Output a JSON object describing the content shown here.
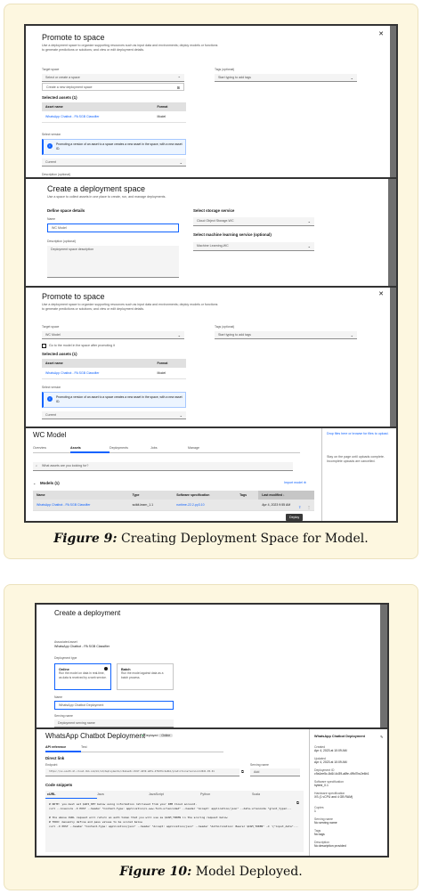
{
  "figure9": {
    "caption_label": "Figure 9:",
    "caption_text": " Creating Deployment Space for Model.",
    "promote1": {
      "title": "Promote to space",
      "description": "Use a deployment space to organize supporting resources such as input data and environments; deploy models or functions to generate predictions or solutions; and view or edit deployment details.",
      "target_space_label": "Target space",
      "target_space_placeholder": "Select or create a space",
      "create_option": "Create a new deployment space",
      "tags_label": "Tags (optional)",
      "tags_placeholder": "Start typing to add tags",
      "selected_assets": "Selected assets (1)",
      "col_asset_name": "Asset name",
      "col_format": "Format",
      "asset_name": "WhatsApp Chatbot - PA SGB Classifier",
      "asset_format": "Model",
      "select_version_label": "Select version",
      "notice": "Promoting a version of an asset to a space creates a new asset in the space, with a new asset ID.",
      "version_value": "Current",
      "description_label": "Description (optional)"
    },
    "create_space": {
      "title": "Create a deployment space",
      "description": "Use a space to collect assets in one place to create, run, and manage deployments.",
      "define_label": "Define space details",
      "name_label": "Name",
      "name_value": "WC Model",
      "desc_label": "Description (optional)",
      "desc_placeholder": "Deployment space description",
      "storage_label": "Select storage service",
      "storage_value": "Cloud Object Storage-WC",
      "ml_label": "Select machine learning service (optional)",
      "ml_value": "Machine Learning-WC"
    },
    "promote2": {
      "title": "Promote to space",
      "description": "Use a deployment space to organize supporting resources such as input data and environments; deploy models or functions to generate predictions or solutions; and view or edit deployment details.",
      "target_space_label": "Target space",
      "target_space_value": "WC Model",
      "goto_label": "Go to the model in the space after promoting it",
      "tags_label": "Tags (optional)",
      "tags_placeholder": "Start typing to add tags",
      "selected_assets": "Selected assets (1)",
      "col_asset_name": "Asset name",
      "col_format": "Format",
      "asset_name": "WhatsApp Chatbot - PA SGB Classifier",
      "asset_format": "Model",
      "select_version_label": "Select version",
      "notice": "Promoting a version of an asset to a space creates a new asset in the space, with a new asset ID.",
      "version_value": "Current"
    },
    "space_view": {
      "title": "WC Model",
      "tabs": [
        "Overview",
        "Assets",
        "Deployments",
        "Jobs",
        "Manage"
      ],
      "active_tab": "Assets",
      "search_placeholder": "What assets are you looking for?",
      "models_heading": "Models (1)",
      "import_link": "Import model",
      "columns": [
        "Name",
        "Type",
        "Software specification",
        "Tags",
        "Last modified"
      ],
      "row": {
        "name": "WhatsApp Chatbot - PA SGB Classifier",
        "type": "scikit-learn_1.1",
        "spec": "runtime-22.2-py3.10",
        "tags": "",
        "modified": "Apr 4, 2023 9:55 AM"
      },
      "tooltip": "Deploy",
      "side_text_1": "Drop files here or browse for files to upload.",
      "side_text_2": "Stay on the page until uploads complete. Incomplete uploads are cancelled."
    }
  },
  "figure10": {
    "caption_label": "Figure 10:",
    "caption_text": " Model Deployed.",
    "create_deploy": {
      "title": "Create a deployment",
      "asset_label": "Associated asset",
      "asset_value": "WhatsApp Chatbot - PA SGB Classifier",
      "deploy_type_label": "Deployment type",
      "online_title": "Online",
      "online_desc": "Run the model on data in real-time, as data is received by a web service.",
      "batch_title": "Batch",
      "batch_desc": "Run the model against data as a batch process.",
      "name_label": "Name",
      "name_value": "WhatsApp Chatbot Deployment",
      "serving_label": "Serving name",
      "serving_placeholder": "Deployment serving name"
    },
    "deployed": {
      "title": "WhatsApp Chatbot Deployment",
      "status": "Deployed",
      "status_tag": "Online",
      "tabs": [
        "API reference",
        "Test"
      ],
      "active_tab": "API reference",
      "direct_link": "Direct link",
      "endpoint_label": "Endpoint",
      "endpoint_value": "https://us-south.ml.cloud.ibm.com/ml/v4/deployments/c9a1ee5c-8d1f-4d39-a8fe-4f9d7bc2e6b1/predictions?version=2021-05-01",
      "serving_label": "Serving name",
      "serving_value": "Add",
      "snippets_label": "Code snippets",
      "code_tabs": [
        "cURL",
        "Java",
        "JavaScript",
        "Python",
        "Scala"
      ],
      "active_code_tab": "cURL",
      "code": "# NOTE: you must set $API_KEY below using information retrieved from your IBM Cloud account.\ncurl --insecure -X POST --header \"Content-Type: application/x-www-form-urlencoded\" --header \"Accept: application/json\" --data-urlencode \"grant_type=...\n\n# the above CURL request will return an auth token that you will use as $IAM_TOKEN in the scoring request below\n# TODO: manually define and pass values to be scored below\ncurl -X POST --header \"Content-Type: application/json\" --header \"Accept: application/json\" --header \"Authorization: Bearer $IAM_TOKEN\" -d '{\"input_data\"...",
      "side_title": "WhatsApp Chatbot Deployment",
      "side_rows": [
        {
          "label": "Created",
          "value": "Apr 4, 2023 at 10:09 AM"
        },
        {
          "label": "Updated",
          "value": "Apr 4, 2023 at 10:09 AM"
        },
        {
          "label": "Deployment ID",
          "value": "c9a1ee5c-8d1f-4d39-a8fe-4f9d7bc2e6b1"
        },
        {
          "label": "Software specification",
          "value": "hybrid_0.1"
        },
        {
          "label": "Hardware specification",
          "value": "XS (1 vCPU and 4 GB RAM)"
        },
        {
          "label": "Copies",
          "value": "1"
        },
        {
          "label": "Serving name",
          "value": "No serving name"
        },
        {
          "label": "Tags",
          "value": "No tags"
        },
        {
          "label": "Description",
          "value": "No description provided"
        }
      ]
    }
  }
}
